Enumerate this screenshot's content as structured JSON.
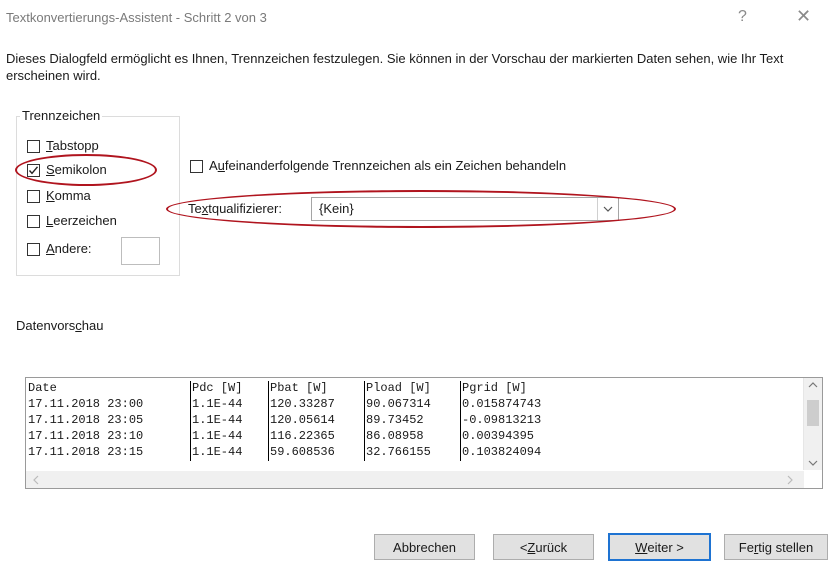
{
  "window": {
    "title": "Textkonvertierungs-Assistent - Schritt 2 von 3",
    "help_glyph": "?",
    "close_glyph": "✕"
  },
  "description": "Dieses Dialogfeld ermöglicht es Ihnen, Trennzeichen festzulegen. Sie können in der Vorschau der markierten Daten sehen, wie Ihr Text erscheinen wird.",
  "delimiters": {
    "group_label": "Trennzeichen",
    "tab": {
      "pre": "",
      "key": "T",
      "post": "abstopp",
      "checked": false
    },
    "semicolon": {
      "pre": "",
      "key": "S",
      "post": "emikolon",
      "checked": true
    },
    "comma": {
      "pre": "",
      "key": "K",
      "post": "omma",
      "checked": false
    },
    "space": {
      "pre": "",
      "key": "L",
      "post": "eerzeichen",
      "checked": false
    },
    "other": {
      "pre": "",
      "key": "A",
      "post": "ndere:",
      "checked": false,
      "value": ""
    }
  },
  "consecutive": {
    "pre": "A",
    "key": "u",
    "post": "feinanderfolgende Trennzeichen als ein Zeichen behandeln",
    "checked": false
  },
  "qualifier": {
    "pre": "Te",
    "key": "x",
    "post": "tqualifizierer:",
    "value": "{Kein}"
  },
  "preview": {
    "label_pre": "Datenvors",
    "label_key": "c",
    "label_post": "hau",
    "rows": [
      [
        "Date",
        "Pdc [W]",
        "Pbat [W]",
        "Pload [W]",
        "Pgrid [W]"
      ],
      [
        "17.11.2018 23:00",
        "1.1E-44",
        "120.33287",
        "90.067314",
        "0.015874743"
      ],
      [
        "17.11.2018 23:05",
        "1.1E-44",
        "120.05614",
        "89.73452",
        "-0.09813213"
      ],
      [
        "17.11.2018 23:10",
        "1.1E-44",
        "116.22365",
        "86.08958",
        "0.00394395"
      ],
      [
        "17.11.2018 23:15",
        "1.1E-44",
        "59.608536",
        "32.766155",
        "0.103824094"
      ]
    ]
  },
  "buttons": {
    "cancel": "Abbrechen",
    "back_pre": "< ",
    "back_key": "Z",
    "back_post": "urück",
    "next_key": "W",
    "next_post": "eiter >",
    "finish_pre": "Fe",
    "finish_key": "r",
    "finish_post": "tig stellen"
  },
  "colors": {
    "annotation_ellipse": "#b0141e",
    "default_button_border": "#1e73d2"
  }
}
